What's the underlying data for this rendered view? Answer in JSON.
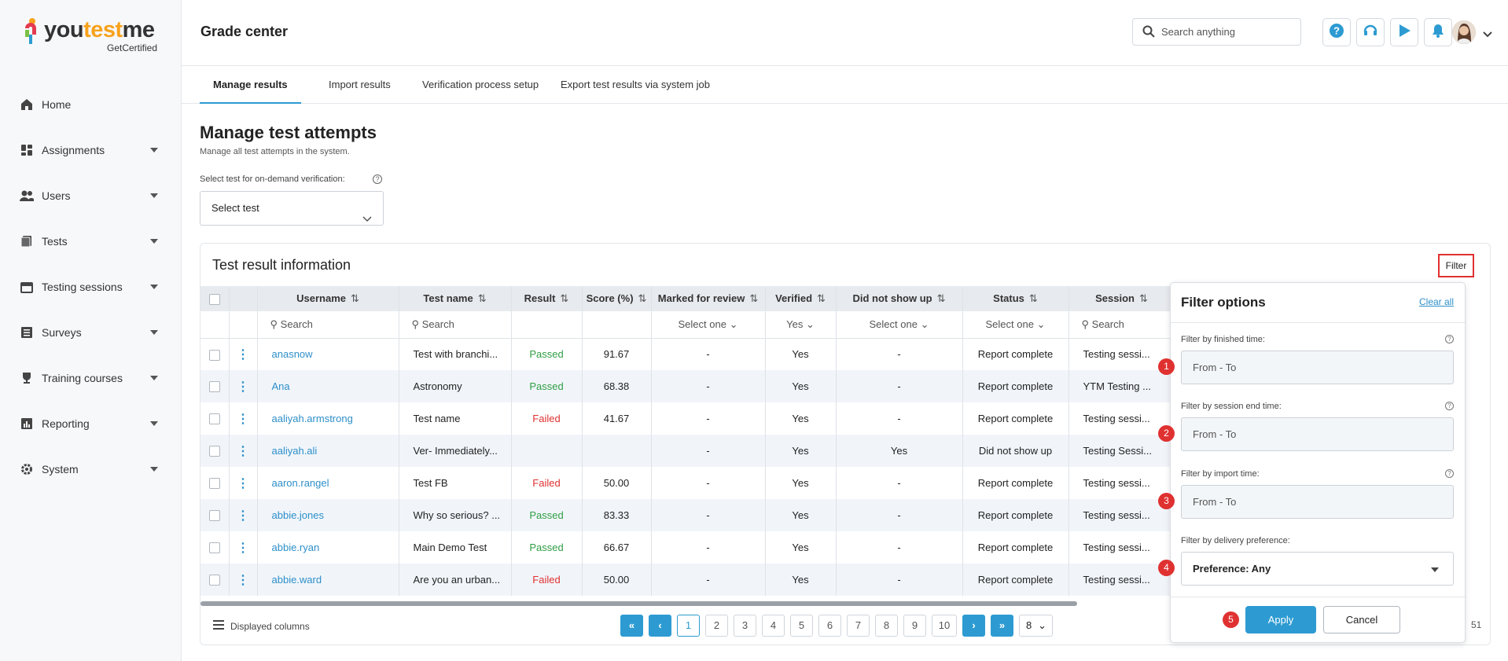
{
  "brand": {
    "name_you": "you",
    "name_test": "test",
    "name_me": "me",
    "sub": "GetCertified"
  },
  "sidebar": {
    "items": [
      {
        "label": "Home",
        "icon": "home-icon"
      },
      {
        "label": "Assignments",
        "icon": "dashboard-icon"
      },
      {
        "label": "Users",
        "icon": "users-icon"
      },
      {
        "label": "Tests",
        "icon": "tests-icon"
      },
      {
        "label": "Testing sessions",
        "icon": "calendar-icon"
      },
      {
        "label": "Surveys",
        "icon": "list-icon"
      },
      {
        "label": "Training courses",
        "icon": "trophy-icon"
      },
      {
        "label": "Reporting",
        "icon": "chart-icon"
      },
      {
        "label": "System",
        "icon": "gear-icon"
      }
    ]
  },
  "header": {
    "title": "Grade center",
    "search_placeholder": "Search anything"
  },
  "tabs": [
    {
      "label": "Manage results"
    },
    {
      "label": "Import results"
    },
    {
      "label": "Verification process setup"
    },
    {
      "label": "Export test results via system job"
    }
  ],
  "main": {
    "title": "Manage test attempts",
    "subtitle": "Manage all test attempts in the system.",
    "select_label": "Select test for on-demand verification:",
    "select_value": "Select test",
    "card_title": "Test result information",
    "filter_label": "Filter"
  },
  "table": {
    "columns": [
      "Username",
      "Test name",
      "Result",
      "Score (%)",
      "Marked for review",
      "Verified",
      "Did not show up",
      "Status",
      "Session"
    ],
    "search": {
      "username": "Search",
      "test_name": "Search",
      "marked": "Select one",
      "verified": "Yes",
      "did_not_show": "Select one",
      "status": "Select one",
      "session": "Search"
    },
    "rows": [
      {
        "username": "anasnow",
        "test": "Test with branchi...",
        "result": "Passed",
        "score": "91.67",
        "marked": "-",
        "verified": "Yes",
        "dnsu": "-",
        "status": "Report complete",
        "session": "Testing sessi..."
      },
      {
        "username": "Ana",
        "test": "Astronomy",
        "result": "Passed",
        "score": "68.38",
        "marked": "-",
        "verified": "Yes",
        "dnsu": "-",
        "status": "Report complete",
        "session": "YTM Testing ..."
      },
      {
        "username": "aaliyah.armstrong",
        "test": "Test name",
        "result": "Failed",
        "score": "41.67",
        "marked": "-",
        "verified": "Yes",
        "dnsu": "-",
        "status": "Report complete",
        "session": "Testing sessi..."
      },
      {
        "username": "aaliyah.ali",
        "test": "Ver- Immediately...",
        "result": "",
        "score": "",
        "marked": "-",
        "verified": "Yes",
        "dnsu": "Yes",
        "status": "Did not show up",
        "session": "Testing Sessi..."
      },
      {
        "username": "aaron.rangel",
        "test": "Test FB",
        "result": "Failed",
        "score": "50.00",
        "marked": "-",
        "verified": "Yes",
        "dnsu": "-",
        "status": "Report complete",
        "session": "Testing sessi..."
      },
      {
        "username": "abbie.jones",
        "test": "Why so serious? ...",
        "result": "Passed",
        "score": "83.33",
        "marked": "-",
        "verified": "Yes",
        "dnsu": "-",
        "status": "Report complete",
        "session": "Testing sessi..."
      },
      {
        "username": "abbie.ryan",
        "test": "Main Demo Test",
        "result": "Passed",
        "score": "66.67",
        "marked": "-",
        "verified": "Yes",
        "dnsu": "-",
        "status": "Report complete",
        "session": "Testing sessi..."
      },
      {
        "username": "abbie.ward",
        "test": "Are you an urban...",
        "result": "Failed",
        "score": "50.00",
        "marked": "-",
        "verified": "Yes",
        "dnsu": "-",
        "status": "Report complete",
        "session": "Testing sessi..."
      }
    ]
  },
  "footer": {
    "displayed_columns": "Displayed columns",
    "pages": [
      "1",
      "2",
      "3",
      "4",
      "5",
      "6",
      "7",
      "8",
      "9",
      "10"
    ],
    "page_size": "8",
    "total_fragment": "51"
  },
  "filter_panel": {
    "title": "Filter options",
    "clear_all": "Clear all",
    "fields": [
      {
        "label": "Filter by finished time:",
        "placeholder": "From - To",
        "marker": "1"
      },
      {
        "label": "Filter by session end time:",
        "placeholder": "From - To",
        "marker": "2"
      },
      {
        "label": "Filter by import time:",
        "placeholder": "From - To",
        "marker": "3"
      }
    ],
    "delivery_label": "Filter by delivery preference:",
    "delivery_value": "Preference: Any",
    "delivery_marker": "4",
    "apply_marker": "5",
    "apply": "Apply",
    "cancel": "Cancel"
  },
  "colors": {
    "accent": "#2d9bd2",
    "passed": "#2f9e44",
    "failed": "#e03131",
    "marker": "#e03131"
  }
}
